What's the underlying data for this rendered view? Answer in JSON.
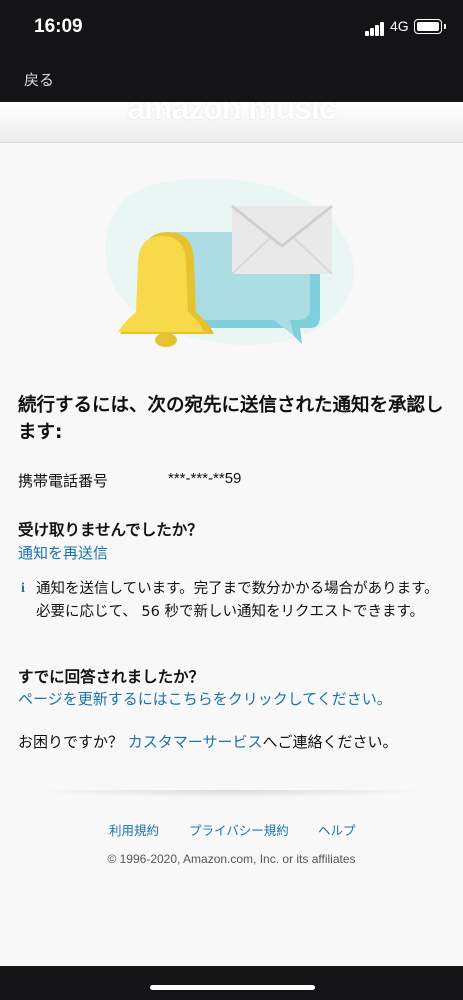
{
  "status_bar": {
    "time": "16:09",
    "network": "4G"
  },
  "nav": {
    "back_label": "戻る"
  },
  "header": {
    "logo_text": "amazon music"
  },
  "content": {
    "heading": "続行するには、次の宛先に送信された通知を承認します:",
    "recipient_label": "携帯電話番号",
    "recipient_value": "***-***-**59",
    "not_received_heading": "受け取りませんでしたか？",
    "resend_link": "通知を再送信",
    "info_text": "通知を送信しています。完了まで数分かかる場合があります。必要に応じて、 56 秒で新しい通知をリクエストできます。",
    "already_answered_heading": "すでに回答されましたか？",
    "refresh_link": "ページを更新するにはこちらをクリックしてください。",
    "help_prefix": "お困りですか？ ",
    "help_link": "カスタマーサービス",
    "help_suffix": "へご連絡ください。"
  },
  "footer": {
    "terms_link": "利用規約",
    "privacy_link": "プライバシー規約",
    "help_link": "ヘルプ",
    "copyright": "© 1996-2020, Amazon.com, Inc. or its affiliates"
  },
  "colors": {
    "link": "#1a73b0",
    "bell": "#f5d73f",
    "bubble": "#a9dde6",
    "envelope": "#eaeaea"
  }
}
